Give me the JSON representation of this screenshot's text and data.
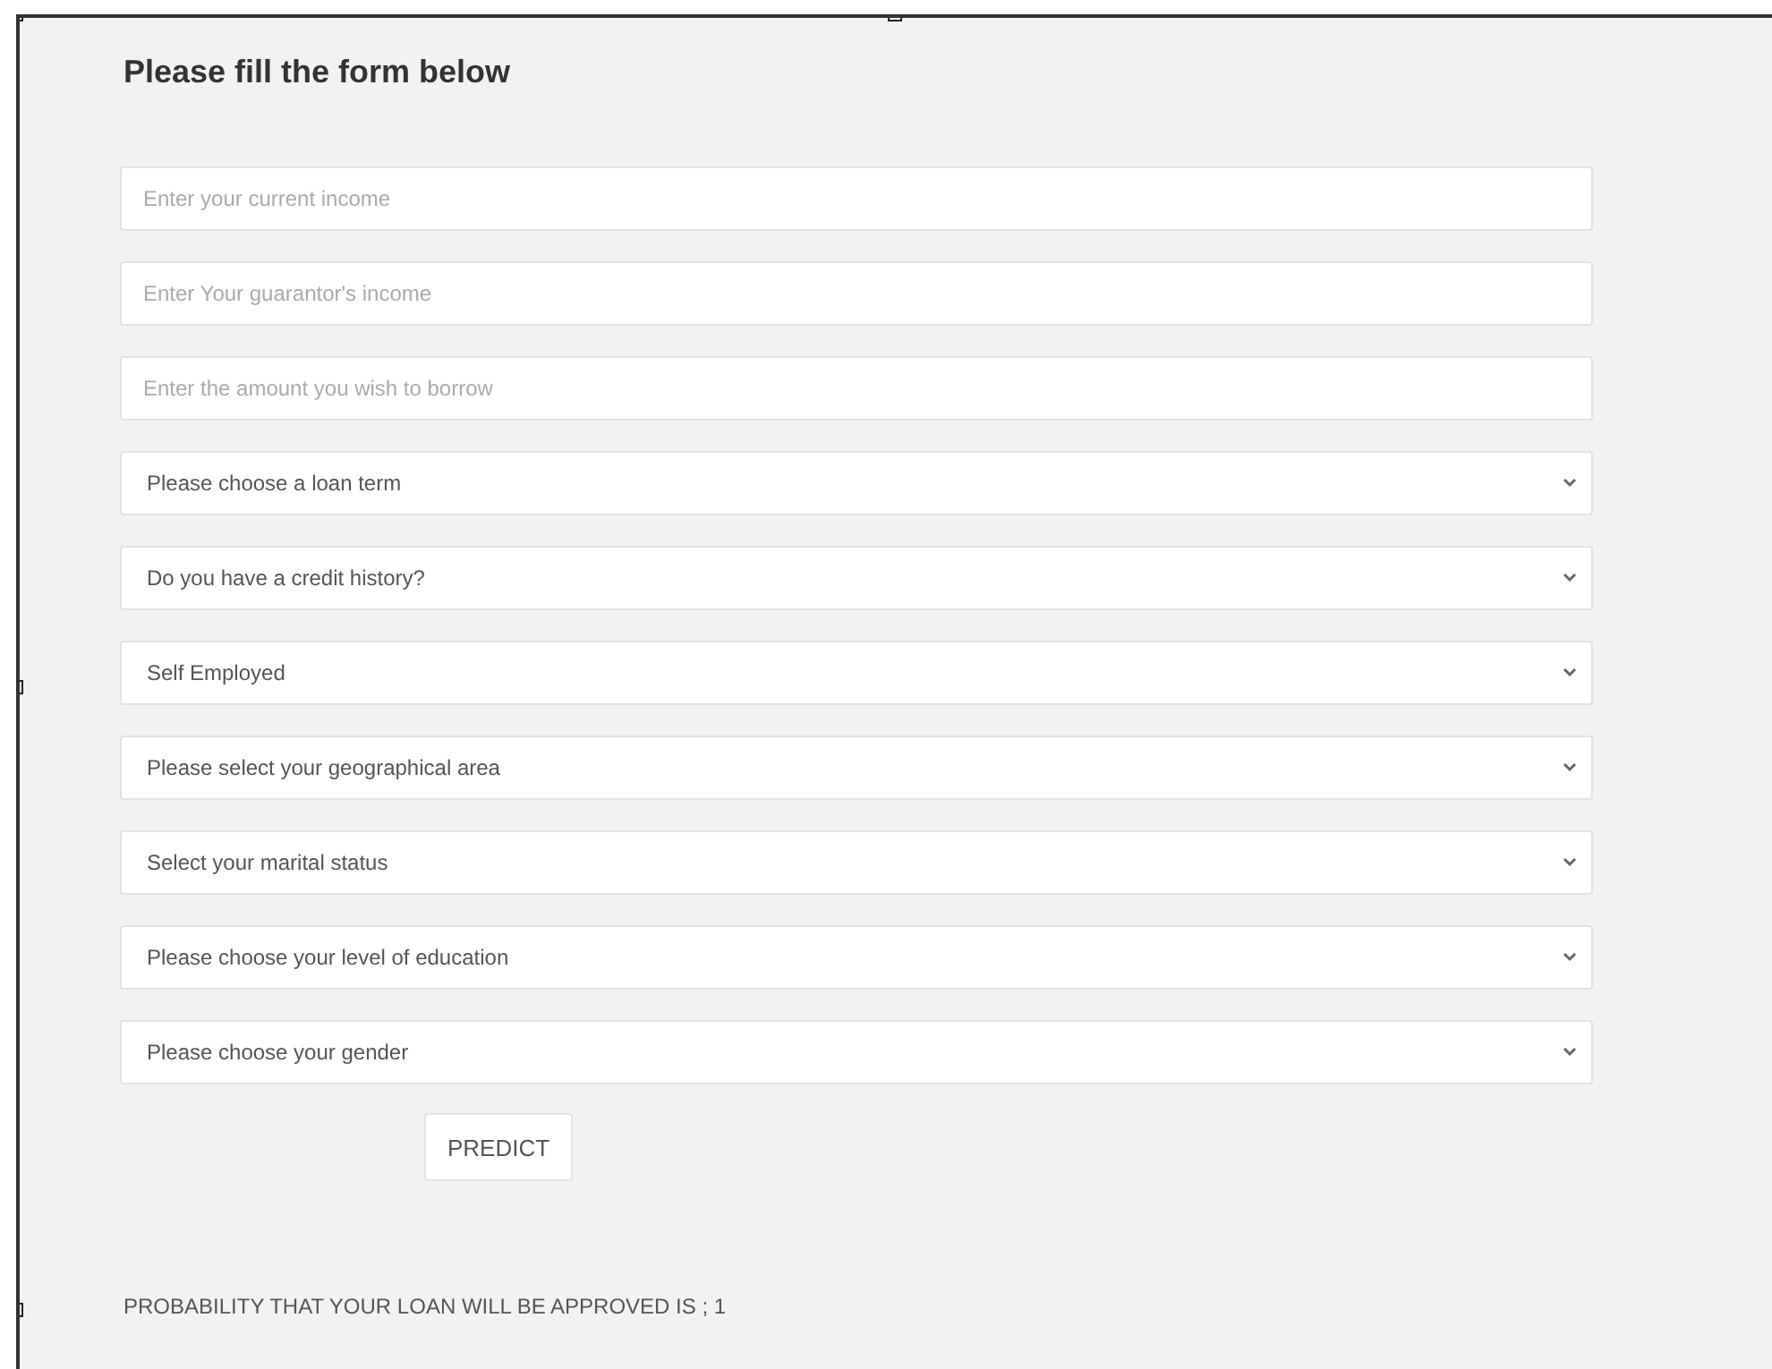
{
  "title": "Please fill the form below",
  "fields": [
    {
      "kind": "input",
      "placeholder": "Enter your current income"
    },
    {
      "kind": "input",
      "placeholder": "Enter Your guarantor's income"
    },
    {
      "kind": "input",
      "placeholder": "Enter the amount you wish to borrow"
    },
    {
      "kind": "select",
      "value": "Please choose a loan term"
    },
    {
      "kind": "select",
      "value": "Do you have a credit history?"
    },
    {
      "kind": "select",
      "value": "Self Employed"
    },
    {
      "kind": "select",
      "value": "Please select your geographical area"
    },
    {
      "kind": "select",
      "value": "Select your marital status"
    },
    {
      "kind": "select",
      "value": "Please choose your level of education"
    },
    {
      "kind": "select",
      "value": "Please choose your gender"
    }
  ],
  "button": "PREDICT",
  "result": "PROBABILITY THAT YOUR LOAN WILL BE APPROVED IS ; 1"
}
